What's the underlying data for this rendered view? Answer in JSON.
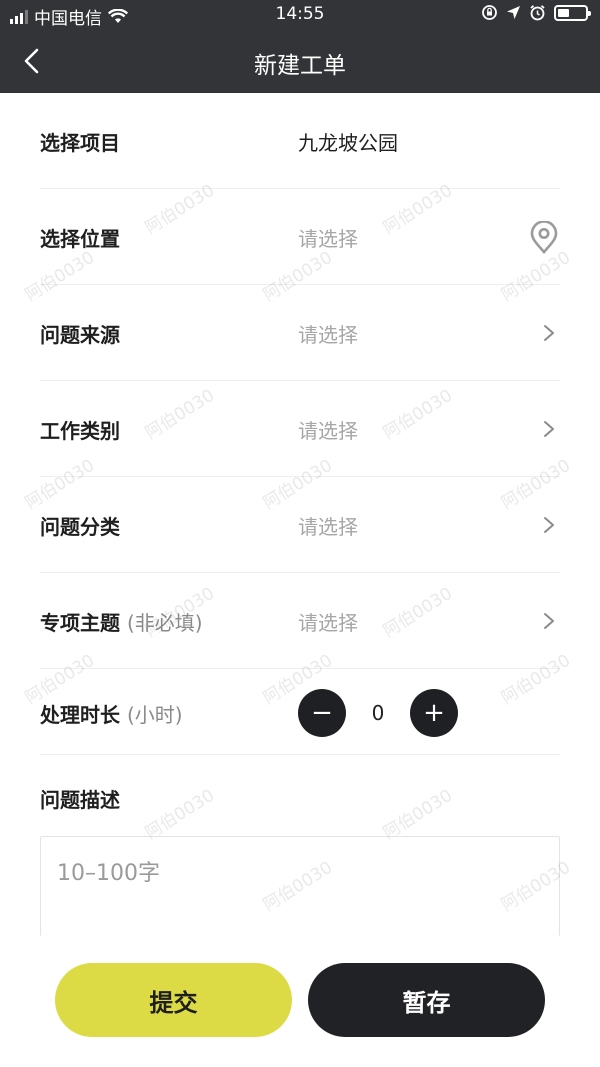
{
  "status": {
    "carrier": "中国电信",
    "time": "14:55"
  },
  "nav": {
    "title": "新建工单"
  },
  "form": {
    "rows": [
      {
        "label": "选择项目",
        "hint": "",
        "value": "九龙坡公园",
        "is_placeholder": false,
        "trailing": "none"
      },
      {
        "label": "选择位置",
        "hint": "",
        "value": "请选择",
        "is_placeholder": true,
        "trailing": "location-pin-icon"
      },
      {
        "label": "问题来源",
        "hint": "",
        "value": "请选择",
        "is_placeholder": true,
        "trailing": "chevron-right-icon"
      },
      {
        "label": "工作类别",
        "hint": "",
        "value": "请选择",
        "is_placeholder": true,
        "trailing": "chevron-right-icon"
      },
      {
        "label": "问题分类",
        "hint": "",
        "value": "请选择",
        "is_placeholder": true,
        "trailing": "chevron-right-icon"
      },
      {
        "label": "专项主题",
        "hint": "(非必填)",
        "value": "请选择",
        "is_placeholder": true,
        "trailing": "chevron-right-icon"
      }
    ],
    "duration": {
      "label": "处理时长",
      "hint": "(小时)",
      "value": "0",
      "minus": "−",
      "plus": "+"
    },
    "description": {
      "label": "问题描述",
      "placeholder": "10–100字"
    }
  },
  "actions": {
    "submit": "提交",
    "draft": "暂存"
  },
  "watermark": "阿伯0030",
  "colors": {
    "header_bg": "#333438",
    "submit_bg": "#dcdb45",
    "draft_bg": "#212226",
    "placeholder": "#a6a6a6"
  }
}
